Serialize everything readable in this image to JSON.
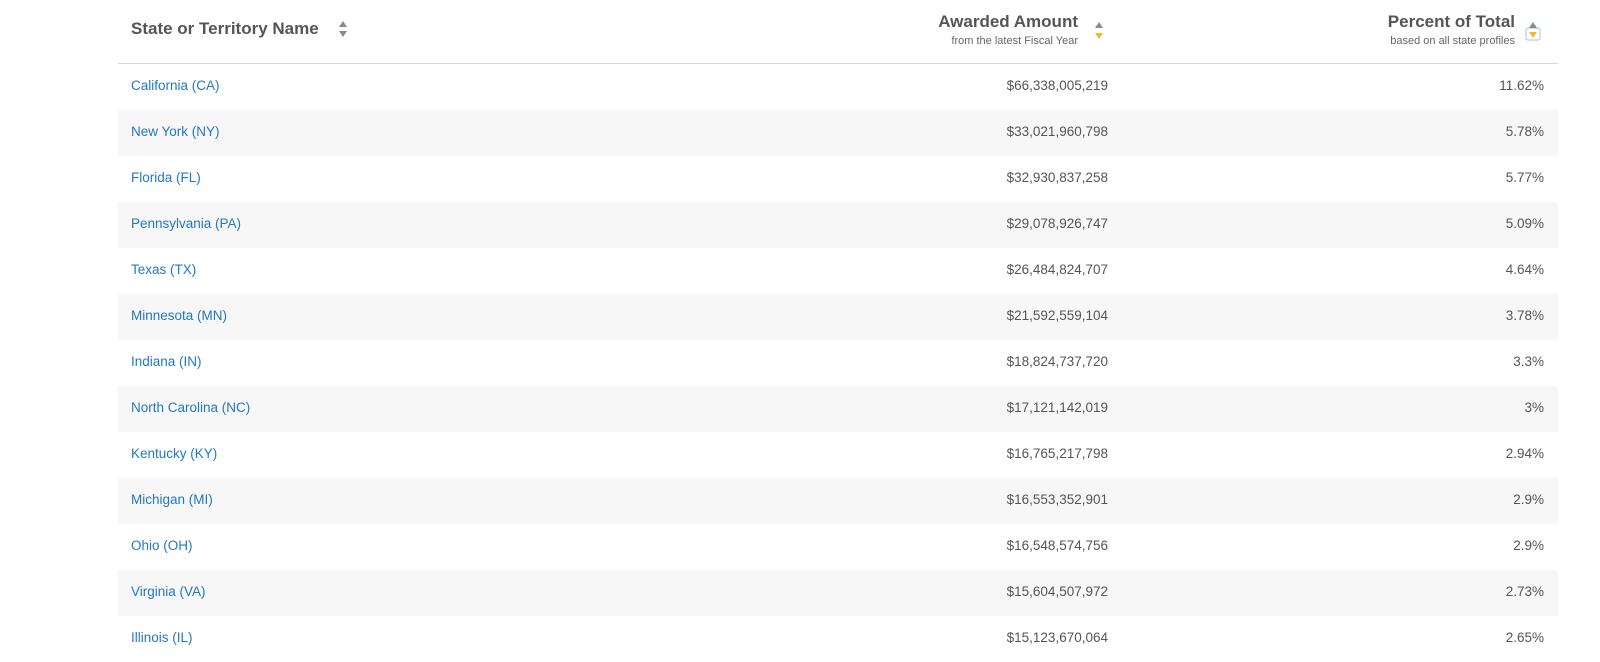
{
  "columns": {
    "state": {
      "title": "State or Territory Name"
    },
    "amount": {
      "title": "Awarded Amount",
      "subtitle": "from the latest Fiscal Year"
    },
    "percent": {
      "title": "Percent of Total",
      "subtitle": "based on all state profiles"
    }
  },
  "sort": {
    "active_column": "percent",
    "direction": "descending",
    "active_color": "#f2b733",
    "inactive_color": "#8a8a8a"
  },
  "colors": {
    "link": "#2378c3",
    "stripe": "#f7f7f7",
    "border": "#d6d7d9"
  },
  "rows": [
    {
      "state": "California (CA)",
      "amount": "$66,338,005,219",
      "percent": "11.62%"
    },
    {
      "state": "New York (NY)",
      "amount": "$33,021,960,798",
      "percent": "5.78%"
    },
    {
      "state": "Florida (FL)",
      "amount": "$32,930,837,258",
      "percent": "5.77%"
    },
    {
      "state": "Pennsylvania (PA)",
      "amount": "$29,078,926,747",
      "percent": "5.09%"
    },
    {
      "state": "Texas (TX)",
      "amount": "$26,484,824,707",
      "percent": "4.64%"
    },
    {
      "state": "Minnesota (MN)",
      "amount": "$21,592,559,104",
      "percent": "3.78%"
    },
    {
      "state": "Indiana (IN)",
      "amount": "$18,824,737,720",
      "percent": "3.3%"
    },
    {
      "state": "North Carolina (NC)",
      "amount": "$17,121,142,019",
      "percent": "3%"
    },
    {
      "state": "Kentucky (KY)",
      "amount": "$16,765,217,798",
      "percent": "2.94%"
    },
    {
      "state": "Michigan (MI)",
      "amount": "$16,553,352,901",
      "percent": "2.9%"
    },
    {
      "state": "Ohio (OH)",
      "amount": "$16,548,574,756",
      "percent": "2.9%"
    },
    {
      "state": "Virginia (VA)",
      "amount": "$15,604,507,972",
      "percent": "2.73%"
    },
    {
      "state": "Illinois (IL)",
      "amount": "$15,123,670,064",
      "percent": "2.65%"
    }
  ]
}
